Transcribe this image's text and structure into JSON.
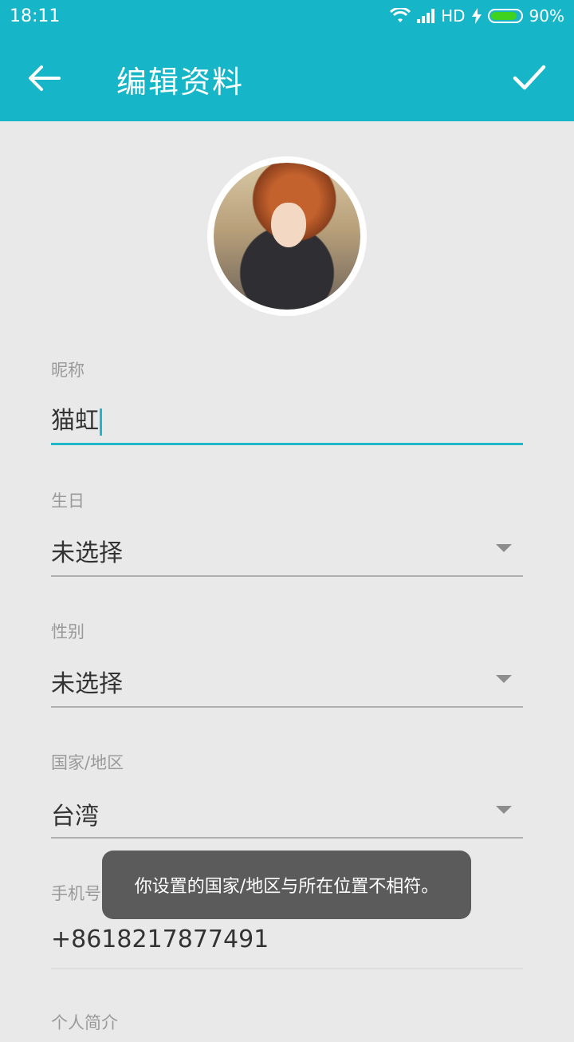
{
  "status_bar": {
    "time": "18:11",
    "network": "HD",
    "battery": "90%",
    "battery_level": 0.9,
    "icons": [
      "wifi-icon",
      "signal-icon",
      "charging-icon",
      "battery-icon"
    ]
  },
  "app_bar": {
    "title": "编辑资料",
    "back_icon": "arrow-left-icon",
    "confirm_icon": "checkmark-icon"
  },
  "profile": {
    "avatar_icon": "profile-avatar"
  },
  "fields": {
    "nickname": {
      "label": "昵称",
      "value": "猫虹"
    },
    "birthday": {
      "label": "生日",
      "value": "未选择"
    },
    "gender": {
      "label": "性别",
      "value": "未选择"
    },
    "country": {
      "label": "国家/地区",
      "value": "台湾"
    },
    "phone": {
      "label": "手机号",
      "value": "+8618217877491"
    },
    "bio": {
      "label": "个人简介"
    }
  },
  "toast": {
    "message": "你设置的国家/地区与所在位置不相符。"
  },
  "colors": {
    "accent": "#16b6c8",
    "background": "#e9e9e9",
    "toast_bg": "#5b5b5b"
  }
}
